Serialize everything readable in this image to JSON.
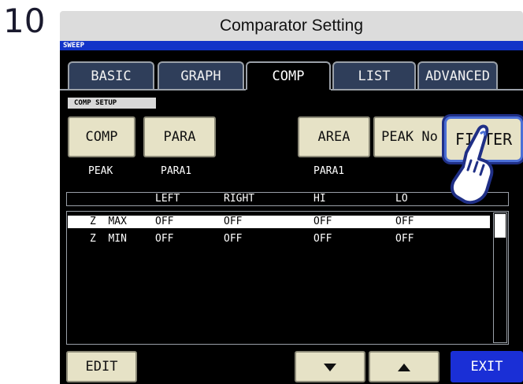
{
  "step_number": "10",
  "window_title": "Comparator Setting",
  "status_label": "SWEEP",
  "tabs": [
    {
      "label": "BASIC",
      "active": false
    },
    {
      "label": "GRAPH",
      "active": false
    },
    {
      "label": "COMP",
      "active": true
    },
    {
      "label": "LIST",
      "active": false
    },
    {
      "label": "ADVANCED",
      "active": false
    }
  ],
  "section_label": "COMP SETUP",
  "buttons": {
    "comp": "COMP",
    "para": "PARA",
    "area": "AREA",
    "peak_no": "PEAK No",
    "filter": "FILTER",
    "edit": "EDIT",
    "exit": "EXIT"
  },
  "button_values": {
    "comp": "PEAK",
    "para": "PARA1",
    "area": "PARA1"
  },
  "table": {
    "columns": [
      "",
      "LEFT",
      "RIGHT",
      "HI",
      "LO"
    ],
    "rows": [
      {
        "name": "Z  MAX",
        "left": "OFF",
        "right": "OFF",
        "hi": "OFF",
        "lo": "OFF",
        "selected": true
      },
      {
        "name": "Z  MIN",
        "left": "OFF",
        "right": "OFF",
        "hi": "OFF",
        "lo": "OFF",
        "selected": false
      }
    ]
  },
  "colors": {
    "accent": "#1234c8",
    "button": "#e6e2c6",
    "tab": "#2f3e5a"
  }
}
